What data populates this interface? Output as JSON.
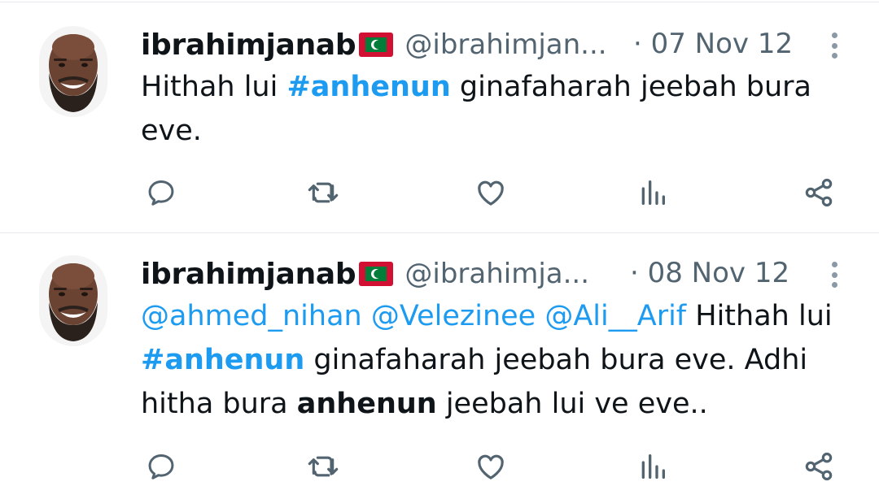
{
  "colors": {
    "accent": "#1d9bf0",
    "secondary_text": "#536471",
    "primary_text": "#0f1419"
  },
  "tweets": [
    {
      "author_name": "ibrahimjanab",
      "flag_icon": "maldives-flag-icon",
      "handle": "@ibrahimjan...",
      "date": "· 07 Nov 12",
      "body": {
        "t1": "Hithah lui ",
        "hashtag": "#anhenun",
        "t2": " ginafaharah jeebah bura eve."
      },
      "actions": [
        "reply-icon",
        "retweet-icon",
        "like-icon",
        "views-icon",
        "share-icon"
      ]
    },
    {
      "author_name": "ibrahimjanab",
      "flag_icon": "maldives-flag-icon",
      "handle": "@ibrahimja...",
      "date": "· 08 Nov 12",
      "body": {
        "m1": "@ahmed_nihan",
        "m2": "@Velezinee",
        "m3": "@Ali__Arif",
        "t1": " Hithah lui ",
        "hashtag": "#anhenun",
        "t2": " ginafaharah jeebah bura eve. Adhi hitha bura ",
        "bold_word": "anhenun",
        "t3": " jeebah lui ve eve.."
      },
      "actions": [
        "reply-icon",
        "retweet-icon",
        "like-icon",
        "views-icon",
        "share-icon"
      ]
    }
  ]
}
